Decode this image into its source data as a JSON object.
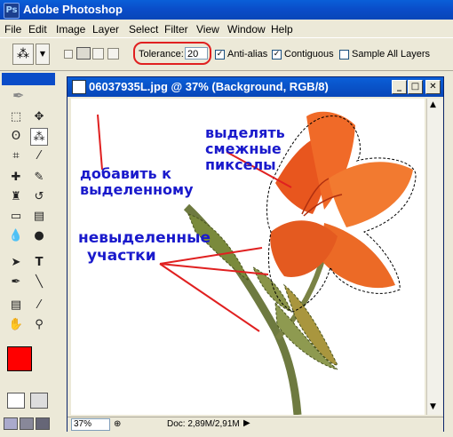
{
  "app": {
    "title": "Adobe Photoshop",
    "icon": "photoshop-app-icon"
  },
  "menu": [
    "File",
    "Edit",
    "Image",
    "Layer",
    "Select",
    "Filter",
    "View",
    "Window",
    "Help"
  ],
  "options": {
    "tolerance_label": "Tolerance:",
    "tolerance_value": "20",
    "anti_alias_label": "Anti-alias",
    "anti_alias_checked": true,
    "contiguous_label": "Contiguous",
    "contiguous_checked": true,
    "sample_all_layers_label": "Sample All Layers",
    "sample_all_layers_checked": false
  },
  "document": {
    "title": "06037935L.jpg @ 37% (Background, RGB/8)",
    "zoom": "37%",
    "doc_size": "Doc: 2,89M/2,91M"
  },
  "colors": {
    "foreground": "#ff0000",
    "background": "#d8d0c8",
    "annotation": "#1a1acc",
    "highlight": "#e02020"
  },
  "annotations": {
    "add_to_selection": [
      "добавить к",
      "выделенному"
    ],
    "select_adjacent": [
      "выделять",
      "смежные",
      "пикселы"
    ],
    "unselected": [
      "невыделенные",
      "участки"
    ]
  }
}
